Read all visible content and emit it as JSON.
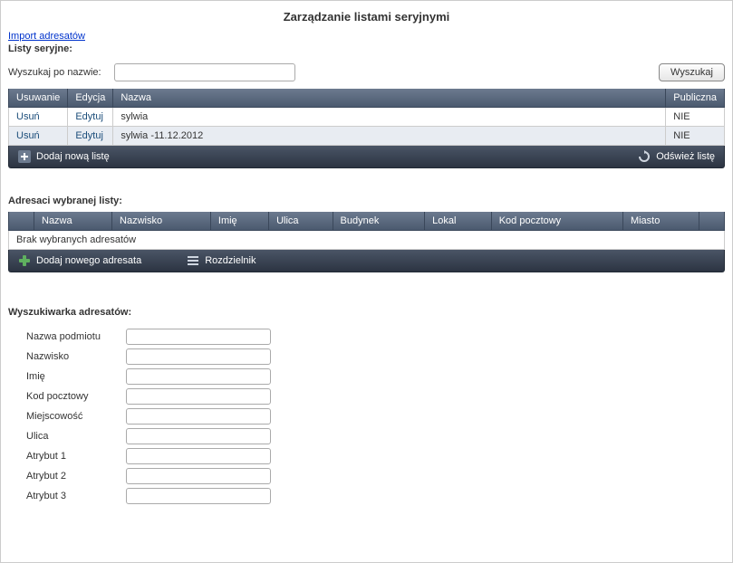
{
  "page_title": "Zarządzanie listami seryjnymi",
  "import_link": "Import adresatów",
  "lists_heading": "Listy seryjne:",
  "search": {
    "label": "Wyszukaj po nazwie:",
    "value": "",
    "button": "Wyszukaj"
  },
  "lists_table": {
    "columns": {
      "delete": "Usuwanie",
      "edit": "Edycja",
      "name": "Nazwa",
      "public": "Publiczna"
    },
    "rows": [
      {
        "delete": "Usuń",
        "edit": "Edytuj",
        "name": "sylwia",
        "public": "NIE"
      },
      {
        "delete": "Usuń",
        "edit": "Edytuj",
        "name": "sylwia -11.12.2012",
        "public": "NIE"
      }
    ],
    "toolbar": {
      "add": "Dodaj nową listę",
      "refresh": "Odśwież listę"
    }
  },
  "recipients": {
    "heading": "Adresaci wybranej listy:",
    "columns": [
      "",
      "Nazwa",
      "Nazwisko",
      "Imię",
      "Ulica",
      "Budynek",
      "Lokal",
      "Kod pocztowy",
      "Miasto",
      ""
    ],
    "empty_text": "Brak wybranych adresatów",
    "toolbar": {
      "add": "Dodaj nowego adresata",
      "distributor": "Rozdzielnik"
    }
  },
  "finder": {
    "heading": "Wyszukiwarka adresatów:",
    "fields": [
      {
        "label": "Nazwa podmiotu",
        "value": ""
      },
      {
        "label": "Nazwisko",
        "value": ""
      },
      {
        "label": "Imię",
        "value": ""
      },
      {
        "label": "Kod pocztowy",
        "value": ""
      },
      {
        "label": "Miejscowość",
        "value": ""
      },
      {
        "label": "Ulica",
        "value": ""
      },
      {
        "label": "Atrybut 1",
        "value": ""
      },
      {
        "label": "Atrybut 2",
        "value": ""
      },
      {
        "label": "Atrybut 3",
        "value": ""
      }
    ]
  }
}
